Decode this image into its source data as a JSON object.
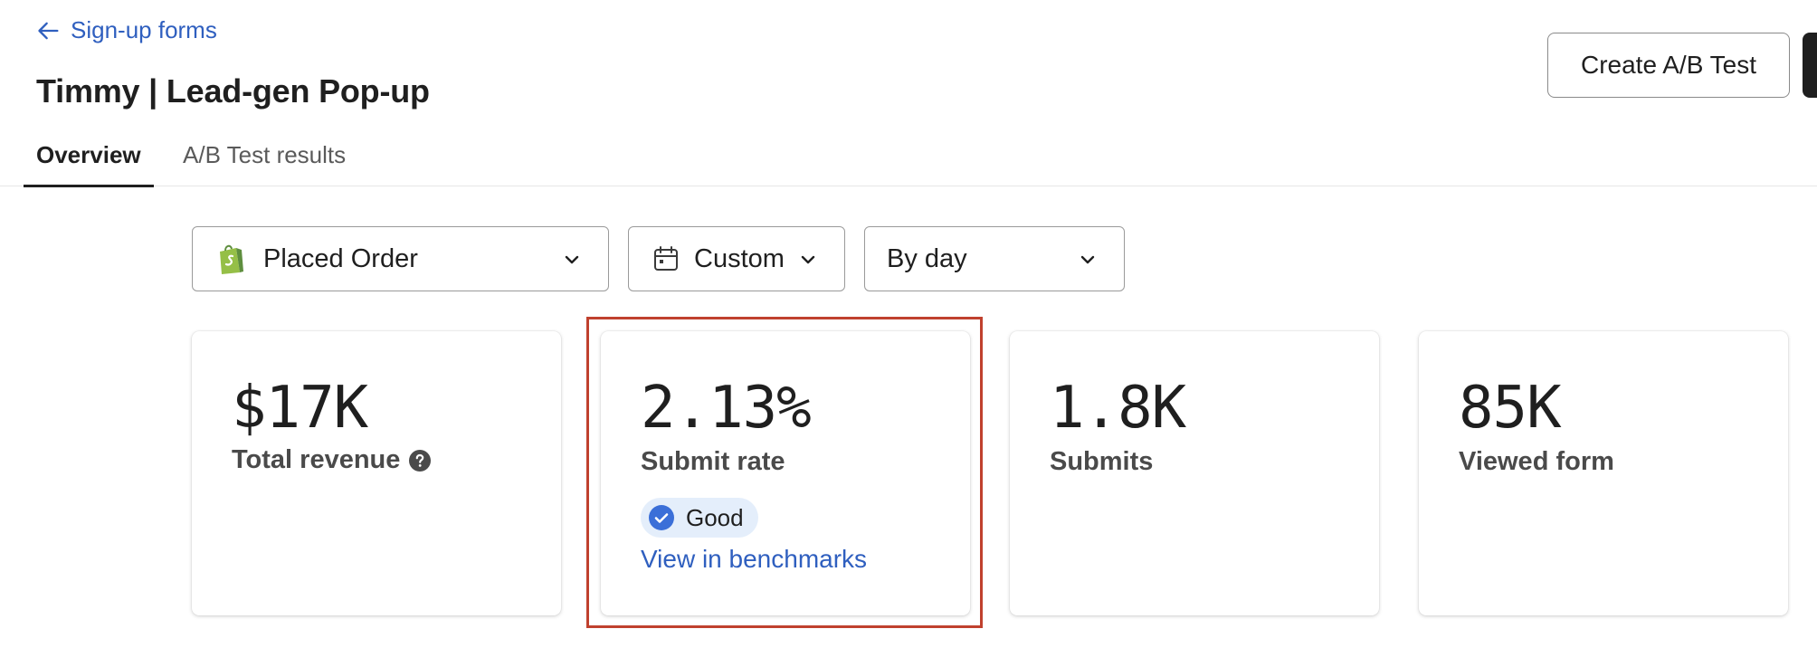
{
  "header": {
    "back_label": "Sign-up forms",
    "title": "Timmy | Lead-gen Pop-up",
    "create_ab_label": "Create A/B Test"
  },
  "tabs": [
    {
      "label": "Overview",
      "active": true
    },
    {
      "label": "A/B Test results",
      "active": false
    }
  ],
  "filters": {
    "metric": "Placed Order",
    "date_range": "Custom",
    "group_by": "By day"
  },
  "cards": {
    "revenue": {
      "value": "$17K",
      "label": "Total revenue"
    },
    "submit_rate": {
      "value": "2.13%",
      "label": "Submit rate",
      "badge": "Good",
      "link": "View in benchmarks"
    },
    "submits": {
      "value": "1.8K",
      "label": "Submits"
    },
    "viewed": {
      "value": "85K",
      "label": "Viewed form"
    }
  },
  "colors": {
    "link": "#2f5fbf",
    "badge_bg": "#e4eefb",
    "badge_icon": "#3b6fd8",
    "highlight": "#c0412e"
  },
  "icons": [
    "arrow-left-icon",
    "shopify-icon",
    "calendar-icon",
    "chevron-down-icon",
    "help-icon",
    "check-circle-icon"
  ]
}
